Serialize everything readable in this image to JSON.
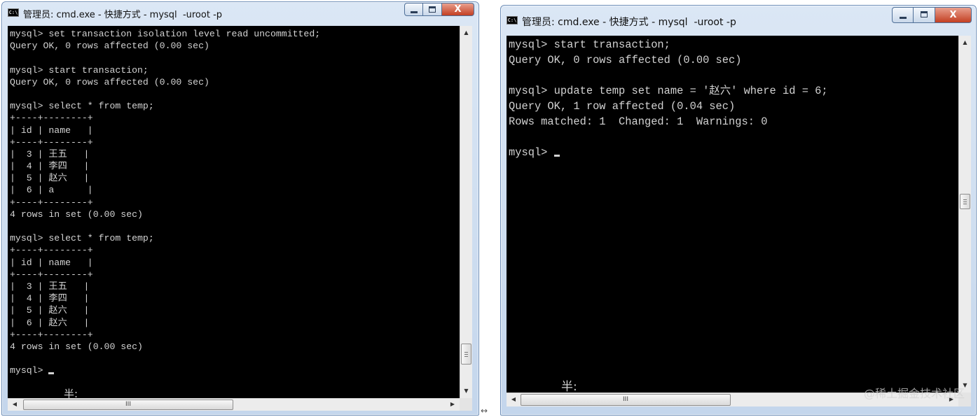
{
  "left_window": {
    "title": "管理员: cmd.exe - 快捷方式 - mysql  -uroot -p",
    "icon_label": "C:\\",
    "lines": [
      "mysql> set transaction isolation level read uncommitted;",
      "Query OK, 0 rows affected (0.00 sec)",
      "",
      "mysql> start transaction;",
      "Query OK, 0 rows affected (0.00 sec)",
      "",
      "mysql> select * from temp;",
      "+----+--------+",
      "| id | name   |",
      "+----+--------+",
      "|  3 | 王五   |",
      "|  4 | 李四   |",
      "|  5 | 赵六   |",
      "|  6 | a      |",
      "+----+--------+",
      "4 rows in set (0.00 sec)",
      "",
      "mysql> select * from temp;",
      "+----+--------+",
      "| id | name   |",
      "+----+--------+",
      "|  3 | 王五   |",
      "|  4 | 李四   |",
      "|  5 | 赵六   |",
      "|  6 | 赵六   |",
      "+----+--------+",
      "4 rows in set (0.00 sec)",
      "",
      "mysql> "
    ],
    "ime_status": "半:",
    "hscroll_thumb_label": "III"
  },
  "right_window": {
    "title": "管理员: cmd.exe - 快捷方式 - mysql  -uroot -p",
    "icon_label": "C:\\",
    "lines": [
      "mysql> start transaction;",
      "Query OK, 0 rows affected (0.00 sec)",
      "",
      "mysql> update temp set name = '赵六' where id = 6;",
      "Query OK, 1 row affected (0.04 sec)",
      "Rows matched: 1  Changed: 1  Warnings: 0",
      "",
      "mysql> "
    ],
    "ime_status": "半:",
    "hscroll_thumb_label": "III"
  },
  "window_controls": {
    "close_label": "X"
  },
  "resize_arrow": "↔",
  "watermark": "@稀土掘金技术社区",
  "colors": {
    "console_bg": "#000000",
    "console_text": "#d2d2d2",
    "title_text": "#111111"
  }
}
